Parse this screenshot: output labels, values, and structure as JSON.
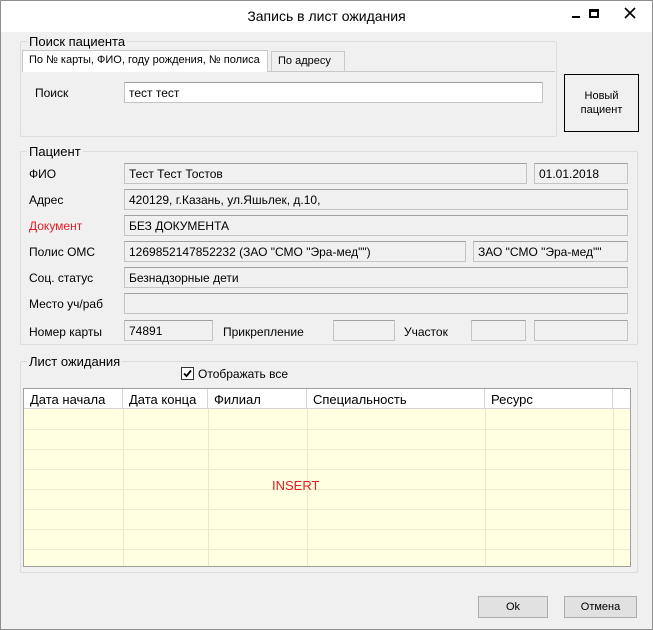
{
  "window": {
    "title": "Запись в лист ожидания"
  },
  "search_group": {
    "title": "Поиск пациента",
    "tabs": [
      {
        "label": "По № карты, ФИО, году рождения, № полиса",
        "active": true
      },
      {
        "label": "По адресу",
        "active": false
      }
    ],
    "search_label": "Поиск",
    "search_value": "тест тест",
    "new_patient_button": "Новый пациент"
  },
  "patient": {
    "title": "Пациент",
    "fio_label": "ФИО",
    "fio_value": "Тест Тест Тостов",
    "birth_date": "01.01.2018",
    "address_label": "Адрес",
    "address_value": "420129, г.Казань, ул.Яшьлек, д.10,",
    "document_label": "Документ",
    "document_value": "БЕЗ ДОКУМЕНТА",
    "oms_label": "Полис ОМС",
    "oms_value": "1269852147852232 (ЗАО \"СМО \"Эра-мед\"\")",
    "oms_company": "ЗАО \"СМО \"Эра-мед\"\"",
    "social_label": "Соц. статус",
    "social_value": "Безнадзорные дети",
    "workplace_label": "Место уч/раб",
    "workplace_value": "",
    "card_label": "Номер карты",
    "card_value": "74891",
    "attachment_label": "Прикрепление",
    "attachment_value": "",
    "district_label": "Участок",
    "district_value": "",
    "district_extra": ""
  },
  "waitlist": {
    "title": "Лист ожидания",
    "show_all_label": "Отображать все",
    "show_all_checked": true,
    "columns": [
      "Дата начала",
      "Дата конца",
      "Филиал",
      "Специальность",
      "Ресурс"
    ],
    "overlay_text": "INSERT"
  },
  "footer": {
    "ok_label": "Ok",
    "cancel_label": "Отмена"
  },
  "colors": {
    "grid_background": "#ffffe1",
    "required_label": "#e51c23"
  }
}
